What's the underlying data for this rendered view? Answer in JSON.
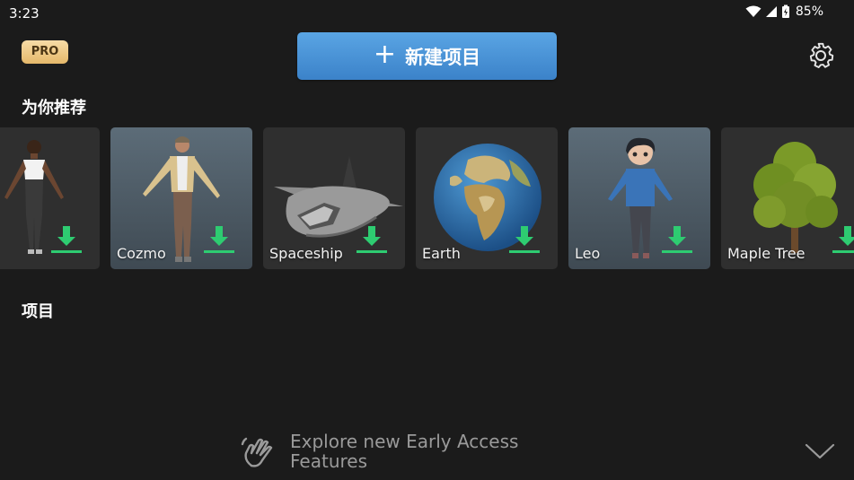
{
  "status": {
    "time": "3:23",
    "battery": "85%"
  },
  "header": {
    "pro_badge": "PRO",
    "new_project_label": "新建项目",
    "plus": "+"
  },
  "recommended": {
    "title": "为你推荐",
    "items": [
      {
        "label": ""
      },
      {
        "label": "Cozmo"
      },
      {
        "label": "Spaceship"
      },
      {
        "label": "Earth"
      },
      {
        "label": "Leo"
      },
      {
        "label": "Maple Tree"
      }
    ]
  },
  "projects": {
    "title": "项目"
  },
  "footer": {
    "line1": "Explore new Early Access",
    "line2": "Features"
  },
  "colors": {
    "accent": "#3f8ad1",
    "download": "#2ecc71",
    "background": "#1b1b1b"
  }
}
